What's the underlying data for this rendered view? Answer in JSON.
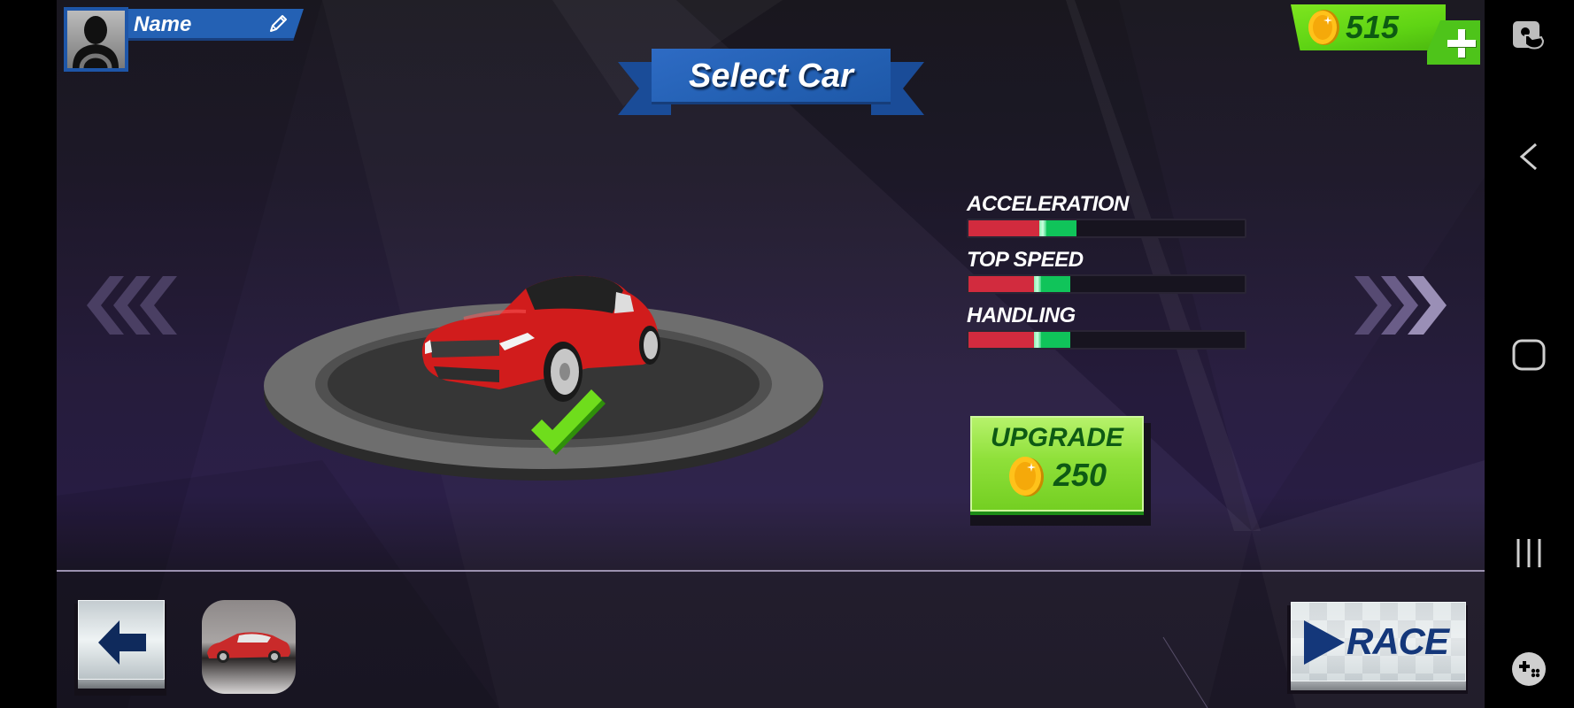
{
  "screen": {
    "title": "Select Car"
  },
  "profile": {
    "name": "Name",
    "avatar_icon": "driver-silhouette-icon",
    "edit_icon": "pencil-icon"
  },
  "currency": {
    "coins": "515",
    "coin_icon": "gold-coin-icon",
    "add_icon": "plus-icon"
  },
  "carousel": {
    "prev_icon": "triple-chevron-left-icon",
    "next_icon": "triple-chevron-right-icon",
    "selected_icon": "checkmark-icon",
    "current_car": "red-sports-coupe"
  },
  "stats": [
    {
      "label": "ACCELERATION",
      "current": 0.26,
      "upgraded": 0.39
    },
    {
      "label": "TOP SPEED",
      "current": 0.24,
      "upgraded": 0.37
    },
    {
      "label": "HANDLING",
      "current": 0.24,
      "upgraded": 0.37
    }
  ],
  "upgrade": {
    "label": "UPGRADE",
    "price": "250"
  },
  "bottom_bar": {
    "back_icon": "arrow-left-icon",
    "garage_thumbnail": "red-suv-thumbnail",
    "race_label": "RACE",
    "race_icon": "play-triangle-icon"
  },
  "system_nav": {
    "items": [
      {
        "name": "touch-lock-icon"
      },
      {
        "name": "back-chevron-icon"
      },
      {
        "name": "home-icon"
      },
      {
        "name": "recents-icon"
      },
      {
        "name": "game-tools-icon"
      }
    ]
  },
  "colors": {
    "bar_current": "#d22b3e",
    "bar_upgrade": "#10c45a",
    "ribbon_blue": "#2461b4",
    "coin_green": "#5fd414",
    "race_text": "#14377a"
  }
}
